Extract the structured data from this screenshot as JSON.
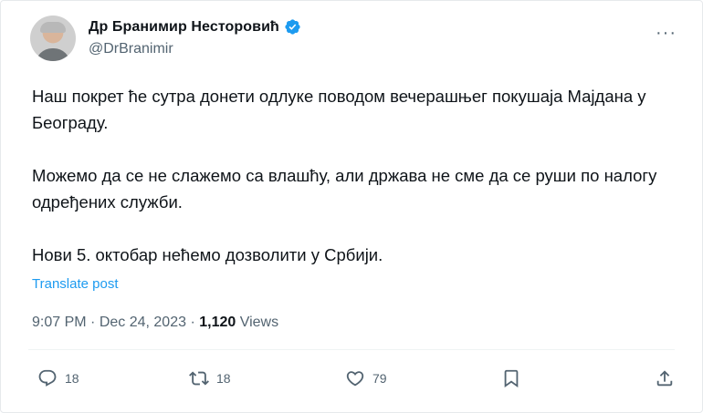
{
  "author": {
    "name": "Др Бранимир Несторовић",
    "handle": "@DrBranimir"
  },
  "more_icon": "more-horizontal-icon",
  "post": {
    "paragraphs": [
      "Наш покрет ће сутра донети одлуке поводом вечерашњег покушаја Мајдана у Београду.",
      "Можемо да се не слажемо са влашћу, али држава не сме да се руши по налогу одређених служби.",
      "Нови 5. октобар нећемо дозволити у Србији."
    ],
    "translate_label": "Translate post"
  },
  "meta": {
    "time": "9:07 PM",
    "separator1": " · ",
    "date": "Dec 24, 2023",
    "separator2": " · ",
    "views_count": "1,120",
    "views_label": " Views"
  },
  "actions": {
    "reply_count": "18",
    "repost_count": "18",
    "like_count": "79"
  },
  "colors": {
    "accent": "#1d9bf0",
    "text": "#0f1419",
    "muted": "#536471"
  }
}
